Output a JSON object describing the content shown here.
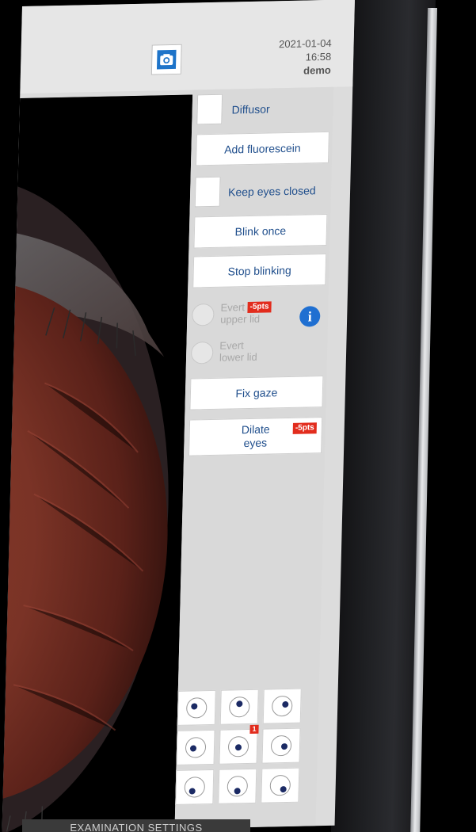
{
  "header": {
    "date": "2021-01-04",
    "time": "16:58",
    "user": "demo",
    "camera_icon": "camera-icon"
  },
  "controls": {
    "diffusor_label": "Diffusor",
    "add_fluorescein_label": "Add fluorescein",
    "keep_eyes_closed_label": "Keep eyes closed",
    "blink_once_label": "Blink once",
    "stop_blinking_label": "Stop blinking",
    "evert_upper_lid_label_1": "Evert",
    "evert_upper_lid_label_2": "upper lid",
    "evert_upper_lid_penalty": "-5pts",
    "evert_lower_lid_label_1": "Evert",
    "evert_lower_lid_label_2": "lower lid",
    "info_icon": "i",
    "fix_gaze_label": "Fix gaze",
    "dilate_eyes_label_1": "Dilate",
    "dilate_eyes_label_2": "eyes",
    "dilate_eyes_penalty": "-5pts"
  },
  "gaze_grid": {
    "center_badge": "1"
  },
  "footer": {
    "tab_label": "EXAMINATION SETTINGS"
  },
  "colors": {
    "accent_blue": "#1f4e8c",
    "penalty_red": "#e22c1d",
    "info_blue": "#1f6fd1"
  }
}
